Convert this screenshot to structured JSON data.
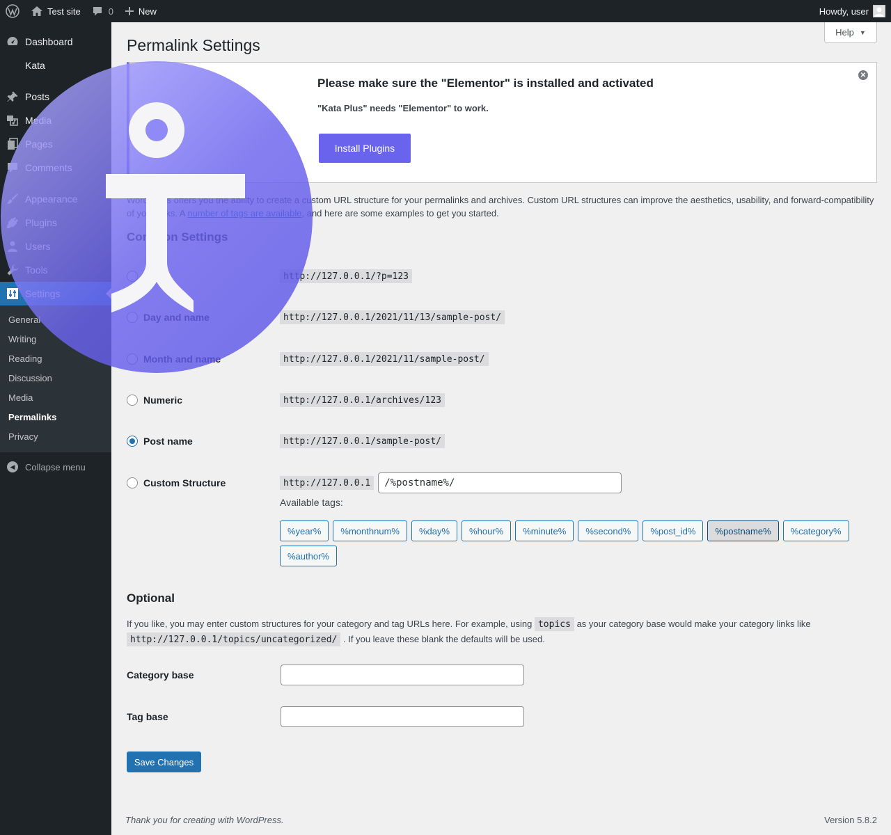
{
  "adminbar": {
    "site_name": "Test site",
    "comments_count": "0",
    "new_label": "New",
    "howdy": "Howdy, user"
  },
  "sidebar": {
    "items": [
      {
        "label": "Dashboard",
        "icon": "dashboard-icon"
      },
      {
        "label": "Kata",
        "icon": ""
      },
      {
        "label": "Posts",
        "icon": "pin-icon"
      },
      {
        "label": "Media",
        "icon": "media-icon"
      },
      {
        "label": "Pages",
        "icon": "pages-icon"
      },
      {
        "label": "Comments",
        "icon": "comments-icon"
      },
      {
        "label": "Appearance",
        "icon": "brush-icon"
      },
      {
        "label": "Plugins",
        "icon": "plugin-icon"
      },
      {
        "label": "Users",
        "icon": "users-icon"
      },
      {
        "label": "Tools",
        "icon": "wrench-icon"
      },
      {
        "label": "Settings",
        "icon": "settings-icon"
      }
    ],
    "submenu": [
      "General",
      "Writing",
      "Reading",
      "Discussion",
      "Media",
      "Permalinks",
      "Privacy"
    ],
    "collapse_label": "Collapse menu"
  },
  "help": {
    "label": "Help"
  },
  "page": {
    "title": "Permalink Settings"
  },
  "notice": {
    "title": "Please make sure the \"Elementor\" is installed and activated",
    "text": "\"Kata Plus\" needs \"Elementor\" to work.",
    "button": "Install Plugins",
    "accent_color": "#7367f0"
  },
  "intro": {
    "text_before": "WordPress offers you the ability to create a custom URL structure for your permalinks and archives. Custom URL structures can improve the aesthetics, usability, and forward-compatibility of your links. A ",
    "link": "number of tags are available",
    "text_after": ", and here are some examples to get you started."
  },
  "common": {
    "heading": "Common Settings",
    "options": [
      {
        "label": "Plain",
        "example": "http://127.0.0.1/?p=123",
        "checked": false
      },
      {
        "label": "Day and name",
        "example": "http://127.0.0.1/2021/11/13/sample-post/",
        "checked": false
      },
      {
        "label": "Month and name",
        "example": "http://127.0.0.1/2021/11/sample-post/",
        "checked": false
      },
      {
        "label": "Numeric",
        "example": "http://127.0.0.1/archives/123",
        "checked": false
      },
      {
        "label": "Post name",
        "example": "http://127.0.0.1/sample-post/",
        "checked": true
      }
    ],
    "custom": {
      "label": "Custom Structure",
      "prefix": "http://127.0.0.1",
      "value": "/%postname%/"
    },
    "available_tags_label": "Available tags:",
    "tags": [
      "%year%",
      "%monthnum%",
      "%day%",
      "%hour%",
      "%minute%",
      "%second%",
      "%post_id%",
      "%postname%",
      "%category%",
      "%author%"
    ],
    "active_tag": "%postname%"
  },
  "optional": {
    "heading": "Optional",
    "desc_1": "If you like, you may enter custom structures for your category and tag URLs here. For example, using ",
    "code_1": "topics",
    "desc_2": " as your category base would make your category links like ",
    "code_2": "http://127.0.0.1/topics/uncategorized/",
    "desc_3": " . If you leave these blank the defaults will be used.",
    "category_label": "Category base",
    "category_value": "",
    "tag_label": "Tag base",
    "tag_value": ""
  },
  "save_label": "Save Changes",
  "footer": {
    "thanks_before": "Thank you for creating with ",
    "thanks_link": "WordPress",
    "thanks_after": ".",
    "version": "Version 5.8.2"
  }
}
